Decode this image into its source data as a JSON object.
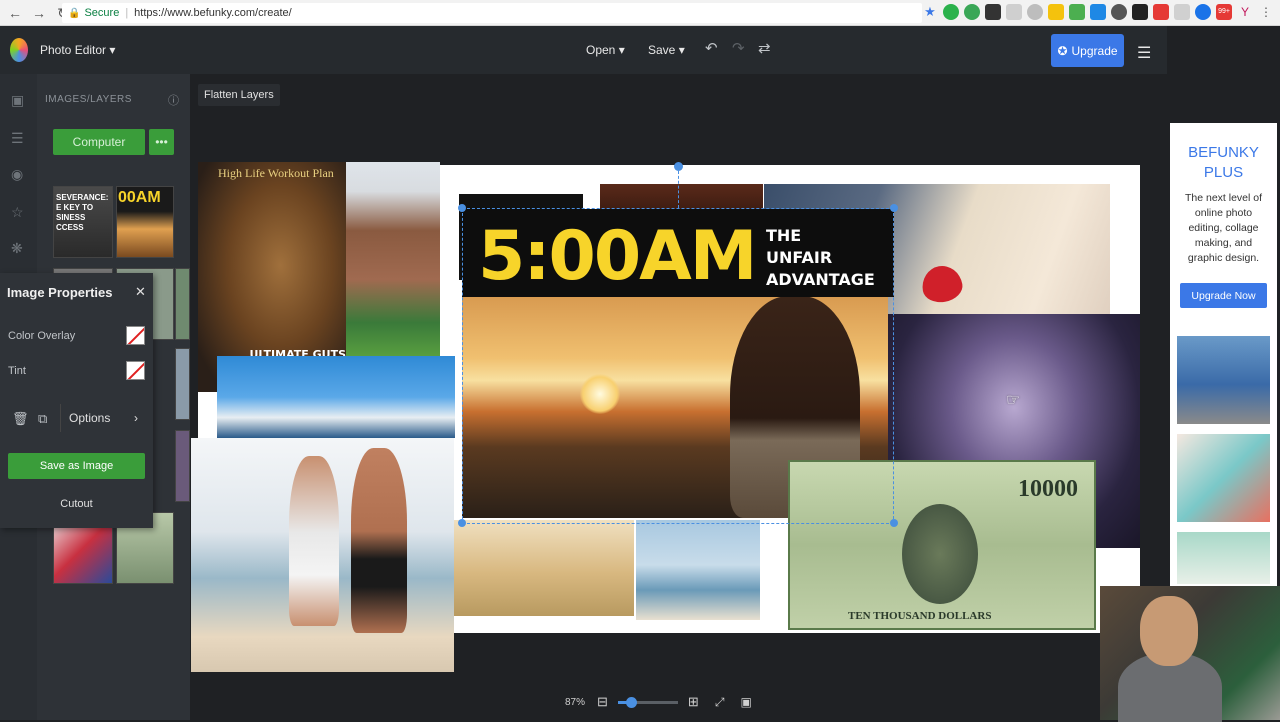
{
  "browser": {
    "secure_label": "Secure",
    "url": "https://www.befunky.com/create/",
    "badge_count": "99+"
  },
  "header": {
    "app_title": "Photo Editor",
    "open_label": "Open",
    "save_label": "Save",
    "upgrade_label": "Upgrade"
  },
  "layers_panel": {
    "title": "IMAGES/LAYERS",
    "computer_label": "Computer",
    "thumb_headline": "00AM",
    "thumb_caption": "SEVERANCE: E KEY TO SINESS CCESS"
  },
  "properties": {
    "title": "Image Properties",
    "color_overlay_label": "Color Overlay",
    "tint_label": "Tint",
    "options_label": "Options",
    "save_as_image_label": "Save as Image",
    "cutout_label": "Cutout"
  },
  "workspace": {
    "flatten_label": "Flatten Layers",
    "zoom_level": "87%"
  },
  "collage": {
    "headline_main": "5:00AM",
    "headline_line1": "THE",
    "headline_line2": "UNFAIR",
    "headline_line3": "ADVANTAGE",
    "workout_title": "High Life Workout Plan",
    "workout_caption": "ULTIMATE GUTS SECRETS TO BURN FAT FAST AS HELL",
    "bill_amount": "10000",
    "bill_text": "TEN THOUSAND DOLLARS"
  },
  "ad": {
    "title_line1": "BEFUNKY",
    "title_line2": "PLUS",
    "text": "The next level of online photo editing, collage making, and graphic design.",
    "button_label": "Upgrade Now"
  }
}
